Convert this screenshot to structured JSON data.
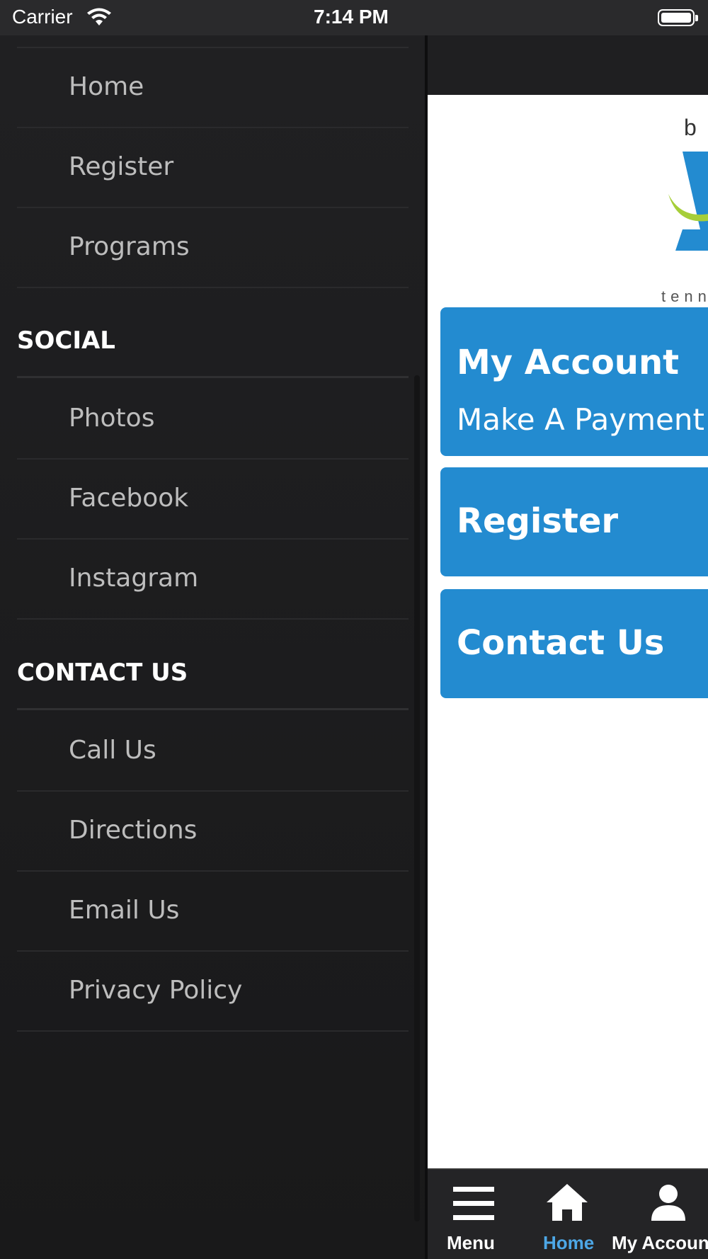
{
  "status_bar": {
    "carrier": "Carrier",
    "time": "7:14 PM"
  },
  "drawer": {
    "items_top": [
      "Home",
      "Register",
      "Programs"
    ],
    "social": {
      "heading": "SOCIAL",
      "items": [
        "Photos",
        "Facebook",
        "Instagram"
      ]
    },
    "contact": {
      "heading": "CONTACT US",
      "items": [
        "Call Us",
        "Directions",
        "Email Us",
        "Privacy Policy"
      ]
    }
  },
  "content": {
    "logo": {
      "top_letter": "b",
      "bottom_text": "tenn"
    },
    "tiles": [
      {
        "title": "My Account",
        "subtitle": "Make A Payment /"
      },
      {
        "title": "Register"
      },
      {
        "title": "Contact Us"
      }
    ]
  },
  "tabbar": {
    "items": [
      {
        "label": "Menu",
        "icon": "menu-icon"
      },
      {
        "label": "Home",
        "icon": "home-icon",
        "active": true
      },
      {
        "label": "My Account",
        "icon": "user-icon"
      }
    ]
  },
  "colors": {
    "accent": "#238bd0",
    "drawer_bg": "#1c1c1e",
    "active_tab": "#4da7e6"
  }
}
